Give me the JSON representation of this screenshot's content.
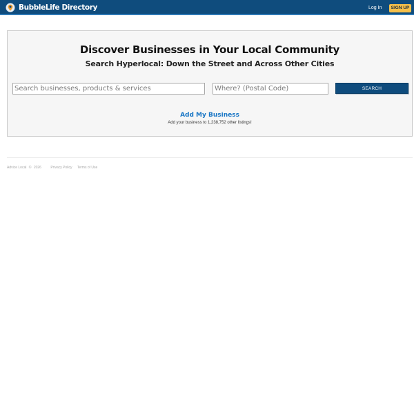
{
  "header": {
    "brand_name": "BubbleLife Directory",
    "login_label": "Log In",
    "signup_label": "SIGN UP",
    "logo_icon": "location-pin-logo-icon"
  },
  "hero": {
    "headline": "Discover Businesses in Your Local Community",
    "subheadline": "Search Hyperlocal: Down the Street and Across Other Cities"
  },
  "search": {
    "what_placeholder": "Search businesses, products & services",
    "what_value": "",
    "where_placeholder": "Where? (Postal Code)",
    "where_value": "",
    "button_label": "SEARCH"
  },
  "add_business": {
    "link_label": "Add My Business",
    "subtext": "Add your business to 1,238,752 other listings!"
  },
  "footer": {
    "brand": "Advice Local",
    "copyright_symbol": "©",
    "year": "2026",
    "privacy_label": "Privacy Policy",
    "terms_label": "Terms of Use"
  },
  "colors": {
    "header_bg": "#0f4c7d",
    "header_border": "#2e78b4",
    "signup_bg": "#f5c04a",
    "link_blue": "#1976c5",
    "panel_bg": "#f6f6f6"
  }
}
